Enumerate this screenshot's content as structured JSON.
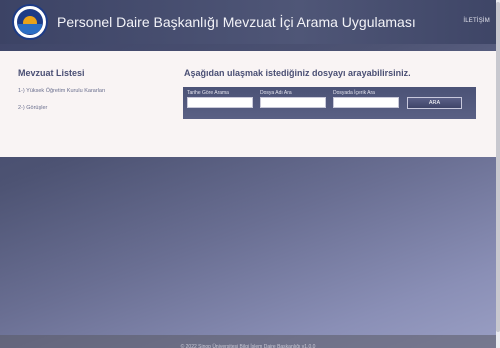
{
  "header": {
    "title": "Personel Daire Başkanlığı Mevzuat İçi Arama Uygulaması",
    "contact_label": "İLETİŞİM",
    "logo_icon": "university-seal-icon"
  },
  "sidebar": {
    "title": "Mevzuat Listesi",
    "items": [
      {
        "label": "1-) Yüksek Öğretim Kurulu Kararları"
      },
      {
        "label": "2-) Görüşler"
      }
    ]
  },
  "main": {
    "heading": "Aşağıdan ulaşmak istediğiniz dosyayı arayabilirsiniz.",
    "search": {
      "date_label": "Tarihe Göre Arama",
      "date_value": "",
      "filename_label": "Dosya Adı Ara",
      "filename_value": "",
      "content_label": "Dosyada İçerik Ara",
      "content_value": "",
      "button_label": "ARA"
    }
  },
  "footer": {
    "text": "© 2022 Sinop Üniversitesi Bilgi İşlem Daire Başkanlığı v1.0.0"
  },
  "colors": {
    "header_bg": "#4a5173",
    "panel_bg": "#f9f4f4",
    "accent_text": "#4a4f74"
  }
}
